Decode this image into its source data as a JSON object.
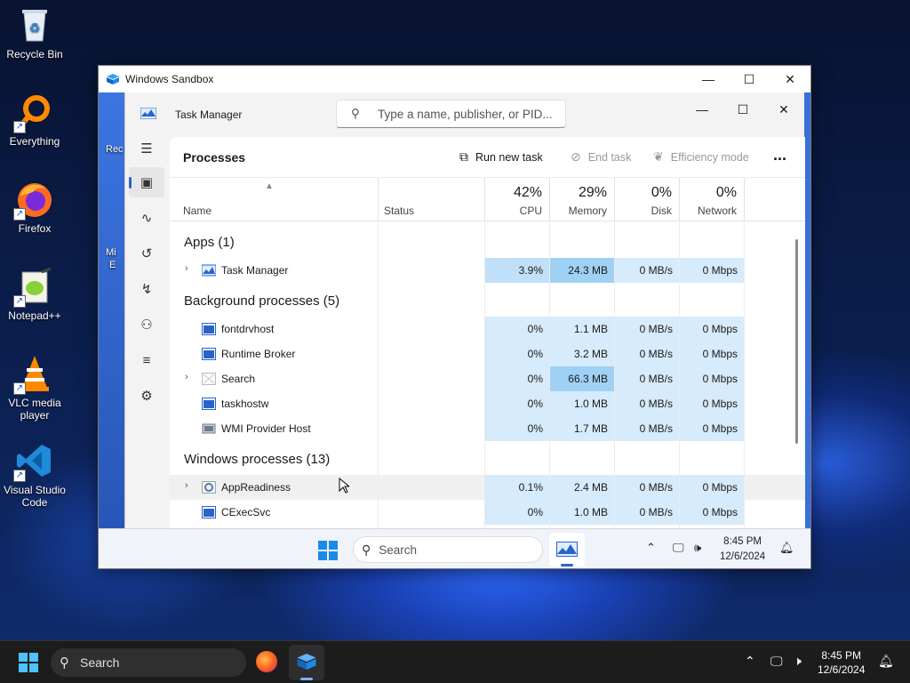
{
  "desktop": {
    "icons": [
      {
        "label": "Recycle Bin",
        "icon": "recycle-bin-icon"
      },
      {
        "label": "Everything",
        "icon": "everything-search-icon"
      },
      {
        "label": "Firefox",
        "icon": "firefox-icon"
      },
      {
        "label": "Notepad++",
        "icon": "notepad-plus-plus-icon"
      },
      {
        "label": "VLC media player",
        "icon": "vlc-icon"
      },
      {
        "label": "Visual Studio Code",
        "icon": "vscode-icon"
      }
    ]
  },
  "sandbox": {
    "title": "Windows Sandbox",
    "inner_desktop_labels": [
      "Rec",
      "Mi",
      "E"
    ]
  },
  "taskmanager": {
    "title": "Task Manager",
    "search_placeholder": "Type a name, publisher, or PID...",
    "page_title": "Processes",
    "toolbar": {
      "run_new_task": "Run new task",
      "end_task": "End task",
      "efficiency_mode": "Efficiency mode",
      "more": "..."
    },
    "columns": {
      "name": "Name",
      "status": "Status",
      "cpu_pct": "42%",
      "cpu": "CPU",
      "memory_pct": "29%",
      "memory": "Memory",
      "disk_pct": "0%",
      "disk": "Disk",
      "network_pct": "0%",
      "network": "Network"
    },
    "groups": {
      "apps": "Apps (1)",
      "background": "Background processes (5)",
      "windows": "Windows processes (13)"
    },
    "apps": [
      {
        "name": "Task Manager",
        "cpu": "3.9%",
        "memory": "24.3 MB",
        "disk": "0 MB/s",
        "network": "0 Mbps"
      }
    ],
    "background": [
      {
        "name": "fontdrvhost",
        "cpu": "0%",
        "memory": "1.1 MB",
        "disk": "0 MB/s",
        "network": "0 Mbps"
      },
      {
        "name": "Runtime Broker",
        "cpu": "0%",
        "memory": "3.2 MB",
        "disk": "0 MB/s",
        "network": "0 Mbps"
      },
      {
        "name": "Search",
        "cpu": "0%",
        "memory": "66.3 MB",
        "disk": "0 MB/s",
        "network": "0 Mbps"
      },
      {
        "name": "taskhostw",
        "cpu": "0%",
        "memory": "1.0 MB",
        "disk": "0 MB/s",
        "network": "0 Mbps"
      },
      {
        "name": "WMI Provider Host",
        "cpu": "0%",
        "memory": "1.7 MB",
        "disk": "0 MB/s",
        "network": "0 Mbps"
      }
    ],
    "windows": [
      {
        "name": "AppReadiness",
        "cpu": "0.1%",
        "memory": "2.4 MB",
        "disk": "0 MB/s",
        "network": "0 Mbps"
      },
      {
        "name": "CExecSvc",
        "cpu": "0%",
        "memory": "1.0 MB",
        "disk": "0 MB/s",
        "network": "0 Mbps"
      }
    ]
  },
  "inner_taskbar": {
    "search": "Search",
    "time": "8:45 PM",
    "date": "12/6/2024"
  },
  "taskbar": {
    "search": "Search",
    "time": "8:45 PM",
    "date": "12/6/2024"
  },
  "colors": {
    "accent": "#2b64c8",
    "cell_light": "#d6ebfb",
    "cell_medium": "#bfe0f8",
    "cell_hot": "#9fd1f5",
    "taskbar": "#1c1c1c"
  }
}
